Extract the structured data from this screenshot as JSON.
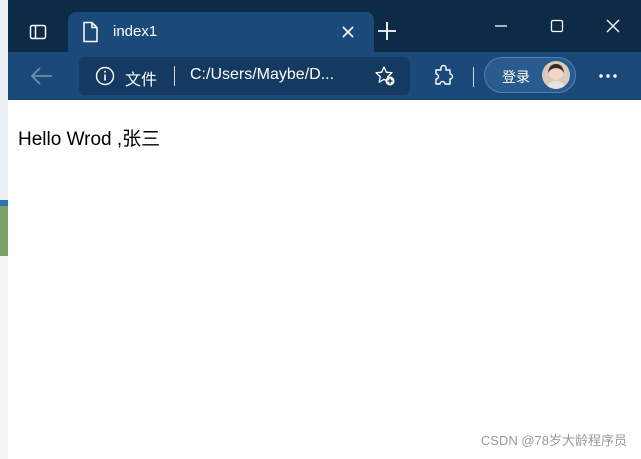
{
  "tab": {
    "title": "index1"
  },
  "address_bar": {
    "scheme_label": "文件",
    "url": "C:/Users/Maybe/D..."
  },
  "profile": {
    "login_label": "登录"
  },
  "page": {
    "text": "Hello Wrod ,张三"
  },
  "watermark": {
    "text": "CSDN @78岁大龄程序员"
  },
  "colors": {
    "titlebar_bg": "#0d2b47",
    "tab_bg": "#1b4a7a",
    "toolbar_bg": "#1b4a7a",
    "address_bg": "#143a61"
  },
  "icons": [
    "tab-actions-icon",
    "file-icon",
    "close-icon",
    "plus-icon",
    "minimize-icon",
    "maximize-icon",
    "window-close-icon",
    "back-arrow-icon",
    "info-icon",
    "favorite-add-icon",
    "extensions-icon",
    "avatar",
    "more-icon"
  ]
}
